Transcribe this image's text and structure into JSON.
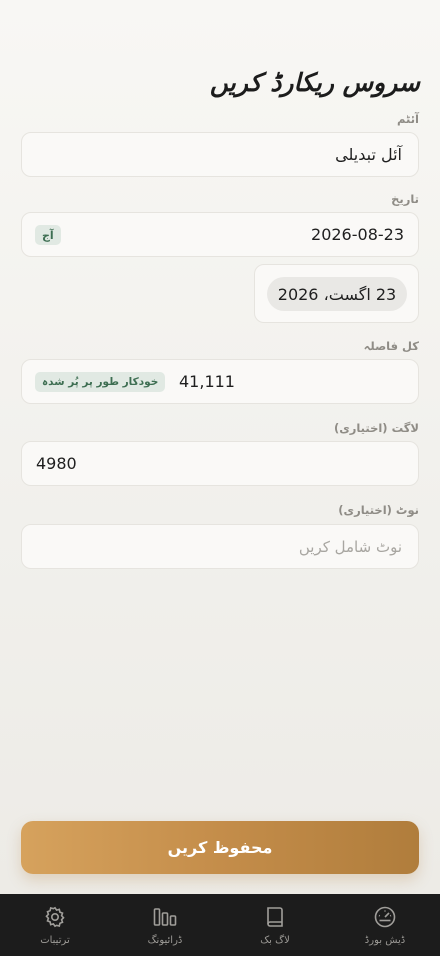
{
  "header": {
    "title": "سروس ریکارڈ کریں"
  },
  "form": {
    "item": {
      "label": "آئٹم",
      "value": "آئل تبدیلی"
    },
    "date": {
      "label": "تاریخ",
      "value": "2026-08-23",
      "today_chip": "آج",
      "display_value": "23 اگست، 2026"
    },
    "odometer": {
      "label": "کل فاصلہ",
      "value": "41,111",
      "auto_chip": "خودکار طور پر پُر شدہ"
    },
    "cost": {
      "label": "لاگت (اختیاری)",
      "value": "4980"
    },
    "note": {
      "label": "نوٹ (اختیاری)",
      "placeholder": "نوٹ شامل کریں"
    }
  },
  "actions": {
    "save_label": "محفوظ کریں"
  },
  "tabs": [
    {
      "label": "ترتیبات",
      "icon": "gear-icon"
    },
    {
      "label": "ڈرائیونگ",
      "icon": "bars-icon"
    },
    {
      "label": "لاگ بک",
      "icon": "book-icon"
    },
    {
      "label": "ڈیش بورڈ",
      "icon": "speedometer-icon"
    }
  ],
  "colors": {
    "accent_start": "#d6a25d",
    "accent_end": "#b07d3c",
    "chip_bg": "#e1e9e3",
    "chip_text": "#3e6e52",
    "tab_bar": "#1c1c1c"
  }
}
